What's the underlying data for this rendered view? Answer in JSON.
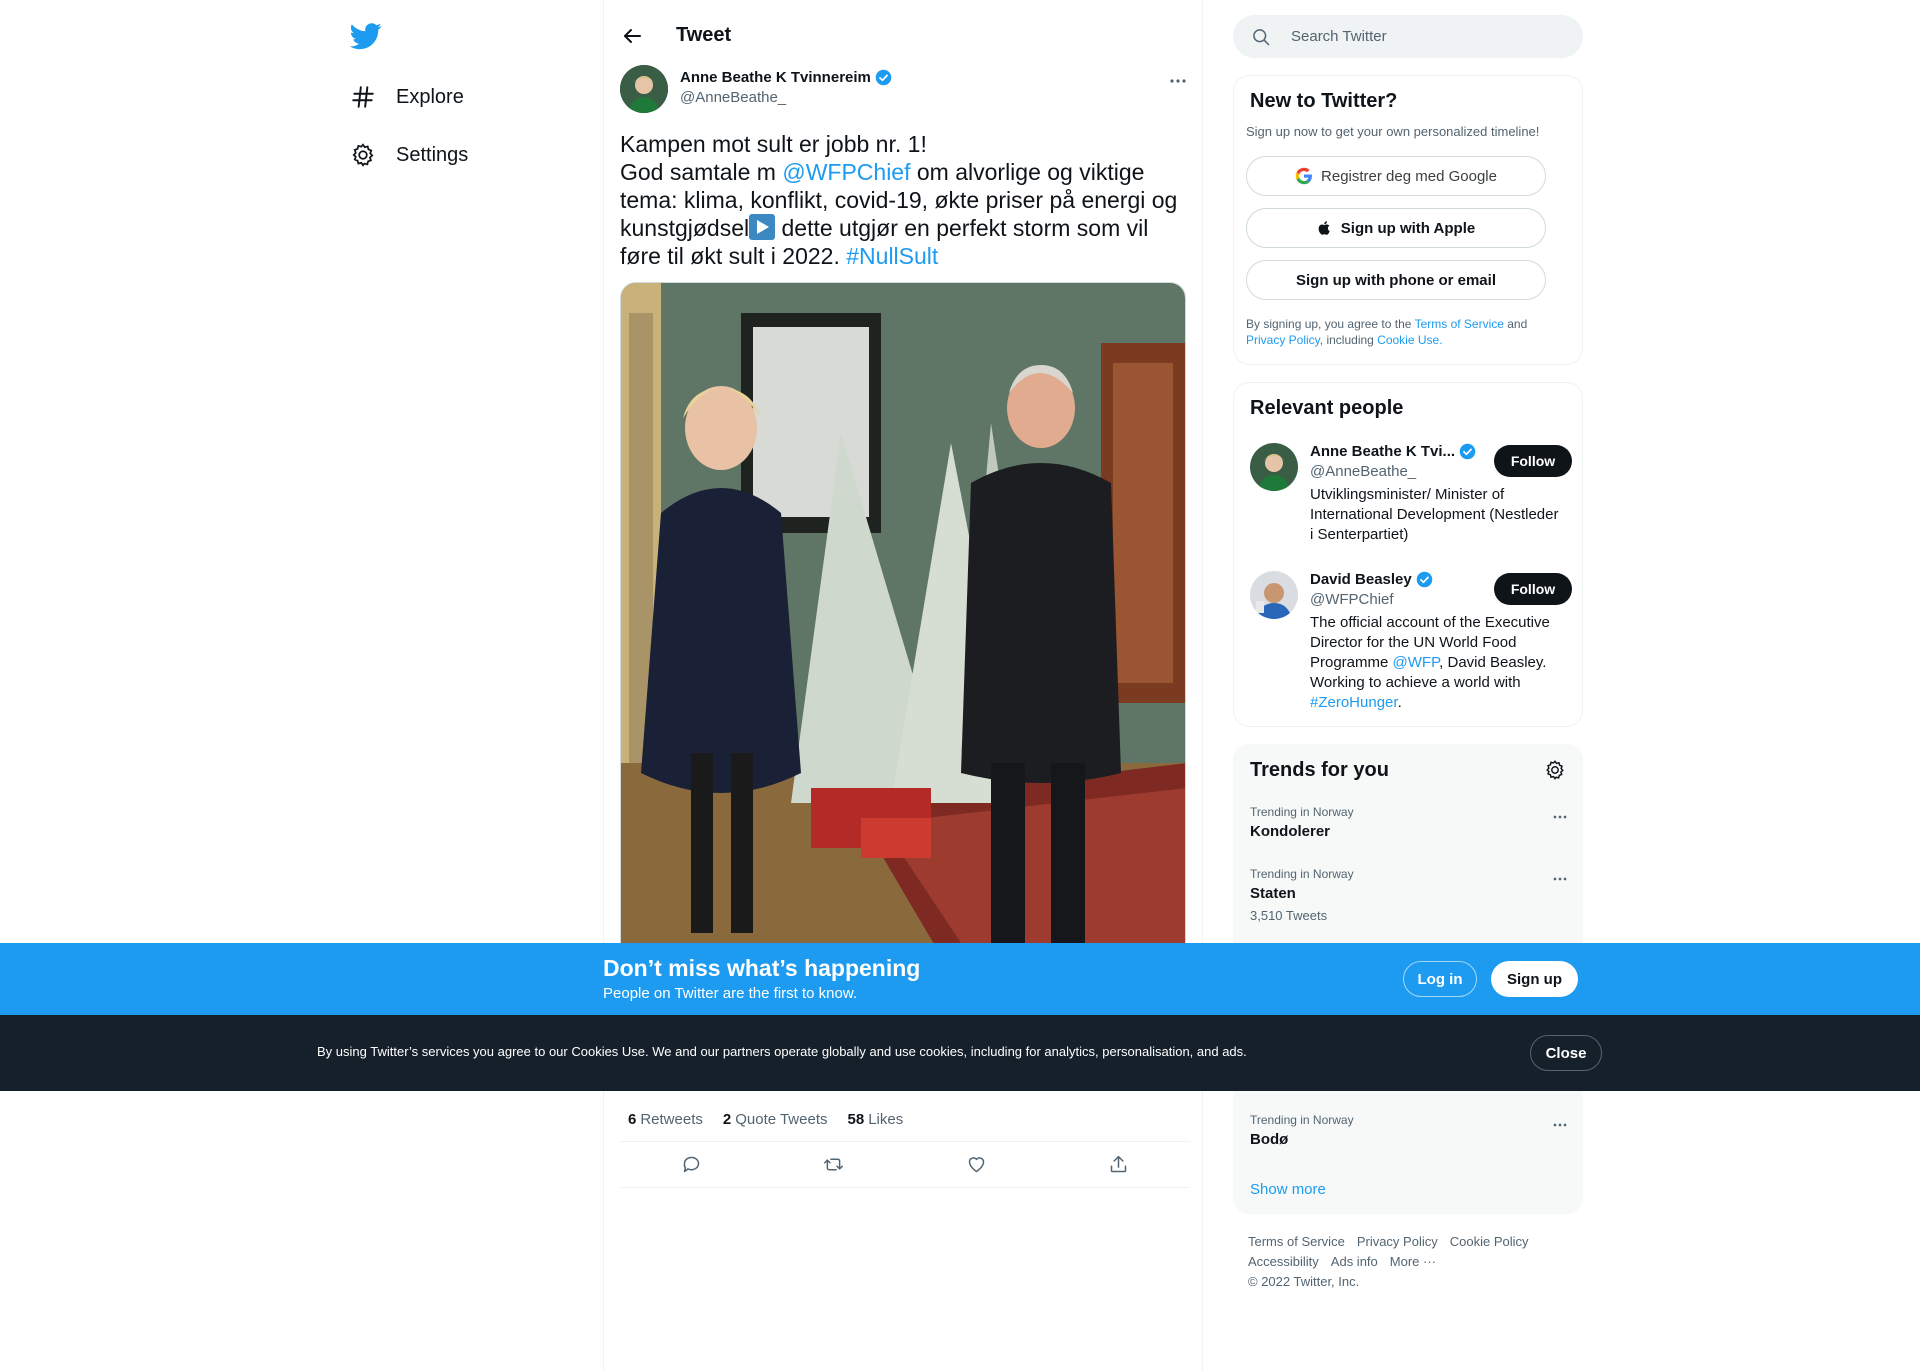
{
  "nav": {
    "items": [
      {
        "label": "Explore",
        "icon": "hashtag-icon"
      },
      {
        "label": "Settings",
        "icon": "gear-icon"
      }
    ]
  },
  "header": {
    "title": "Tweet"
  },
  "tweet": {
    "author_name": "Anne Beathe K Tvinnereim",
    "author_handle": "@AnneBeathe_",
    "text_line1": "Kampen mot sult er jobb nr. 1!",
    "text_part1": "God samtale m ",
    "mention": "@WFPChief",
    "text_part2": " om alvorlige og viktige tema: klima, konflikt, covid-19, økte priser på energi og kunstgjødsel",
    "text_part3": " dette utgjør en perfekt storm som vil føre til økt sult i 2022. ",
    "hashtag": "#NullSult",
    "stats": {
      "retweets_count": "6",
      "retweets_label": "Retweets",
      "quotes_count": "2",
      "quotes_label": "Quote Tweets",
      "likes_count": "58",
      "likes_label": "Likes"
    }
  },
  "search": {
    "placeholder": "Search Twitter"
  },
  "new_to_twitter": {
    "title": "New to Twitter?",
    "subtitle": "Sign up now to get your own personalized timeline!",
    "google_label": "Registrer deg med Google",
    "apple_label": "Sign up with Apple",
    "phone_label": "Sign up with phone or email",
    "terms_prefix": "By signing up, you agree to the ",
    "terms_link": "Terms of Service",
    "terms_and": " and ",
    "privacy_link": "Privacy Policy",
    "terms_including": ", including ",
    "cookie_link": "Cookie Use."
  },
  "relevant_people": {
    "title": "Relevant people",
    "people": [
      {
        "name": "Anne Beathe K Tvi...",
        "handle": "@AnneBeathe_",
        "bio": "Utviklingsminister/ Minister of International Development (Nestleder i Senterpartiet)",
        "follow_label": "Follow"
      },
      {
        "name": "David Beasley",
        "handle": "@WFPChief",
        "bio_part1": "The official account of the Executive Director for the UN World Food Programme ",
        "bio_link1": "@WFP",
        "bio_part2": ", David Beasley. Working to achieve a world with ",
        "bio_link2": "#ZeroHunger",
        "bio_part3": ".",
        "follow_label": "Follow"
      }
    ]
  },
  "trends": {
    "title": "Trends for you",
    "items": [
      {
        "context": "Trending in Norway",
        "name": "Kondolerer",
        "count": ""
      },
      {
        "context": "Trending in Norway",
        "name": "Staten",
        "count": "3,510 Tweets"
      },
      {
        "context": "Trending in Norway",
        "name": "Bodø",
        "count": ""
      }
    ],
    "show_more": "Show more"
  },
  "footer": {
    "links": [
      "Terms of Service",
      "Privacy Policy",
      "Cookie Policy",
      "Accessibility",
      "Ads info",
      "More ···"
    ],
    "copyright": "© 2022 Twitter, Inc."
  },
  "banner": {
    "title": "Don’t miss what’s happening",
    "subtitle": "People on Twitter are the first to know.",
    "login_label": "Log in",
    "signup_label": "Sign up"
  },
  "cookie_bar": {
    "text": "By using Twitter’s services you agree to our Cookies Use. We and our partners operate globally and use cookies, including for analytics, personalisation, and ads.",
    "close_label": "Close"
  },
  "colors": {
    "accent": "#1d9bf0",
    "text": "#0f1419",
    "muted": "#536471",
    "cookie_bg": "#15202b"
  }
}
